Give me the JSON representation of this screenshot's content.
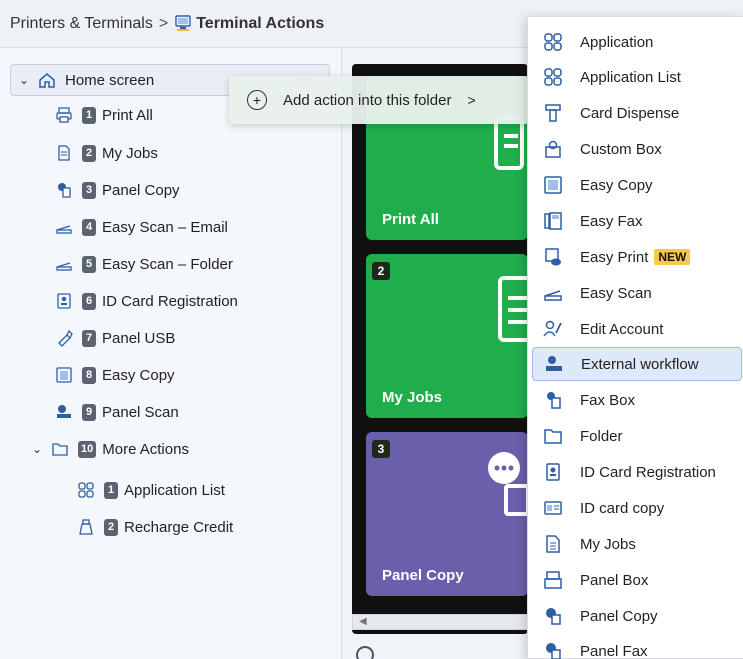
{
  "header": {
    "breadcrumb": "Printers & Terminals",
    "separator": ">",
    "title": "Terminal Actions"
  },
  "tree": {
    "root": "Home screen",
    "items": [
      {
        "num": "1",
        "label": "Print All"
      },
      {
        "num": "2",
        "label": "My Jobs"
      },
      {
        "num": "3",
        "label": "Panel Copy"
      },
      {
        "num": "4",
        "label": "Easy Scan – Email"
      },
      {
        "num": "5",
        "label": "Easy Scan – Folder"
      },
      {
        "num": "6",
        "label": "ID Card Registration"
      },
      {
        "num": "7",
        "label": "Panel USB"
      },
      {
        "num": "8",
        "label": "Easy Copy"
      },
      {
        "num": "9",
        "label": "Panel Scan"
      },
      {
        "num": "10",
        "label": "More Actions"
      }
    ],
    "subitems": [
      {
        "num": "1",
        "label": "Application List"
      },
      {
        "num": "2",
        "label": "Recharge Credit"
      }
    ]
  },
  "context_menu": {
    "label": "Add action into this folder",
    "arrow": ">",
    "dots": "•••"
  },
  "preview": {
    "tiles": [
      {
        "badge": "",
        "label": "Print All",
        "color": "#1fae4b"
      },
      {
        "badge": "2",
        "label": "My Jobs",
        "color": "#1fae4b"
      },
      {
        "badge": "3",
        "label": "Panel Copy",
        "color": "#6a5fab"
      }
    ]
  },
  "action_menu": {
    "items": [
      {
        "label": "Application",
        "icon": "grid-icon"
      },
      {
        "label": "Application List",
        "icon": "grid-icon"
      },
      {
        "label": "Card Dispense",
        "icon": "card-dispense-icon"
      },
      {
        "label": "Custom Box",
        "icon": "box-icon"
      },
      {
        "label": "Easy Copy",
        "icon": "copy-icon"
      },
      {
        "label": "Easy Fax",
        "icon": "fax-icon"
      },
      {
        "label": "Easy Print",
        "icon": "print-cloud-icon",
        "badge": "NEW"
      },
      {
        "label": "Easy Scan",
        "icon": "scan-icon"
      },
      {
        "label": "Edit Account",
        "icon": "account-icon"
      },
      {
        "label": "External workflow",
        "icon": "workflow-icon",
        "selected": true
      },
      {
        "label": "Fax Box",
        "icon": "fax-box-icon"
      },
      {
        "label": "Folder",
        "icon": "folder-icon"
      },
      {
        "label": "ID Card Registration",
        "icon": "id-card-icon"
      },
      {
        "label": "ID card copy",
        "icon": "id-copy-icon"
      },
      {
        "label": "My Jobs",
        "icon": "document-icon"
      },
      {
        "label": "Panel Box",
        "icon": "panel-box-icon"
      },
      {
        "label": "Panel Copy",
        "icon": "panel-copy-icon"
      },
      {
        "label": "Panel Fax",
        "icon": "panel-fax-icon"
      }
    ]
  }
}
